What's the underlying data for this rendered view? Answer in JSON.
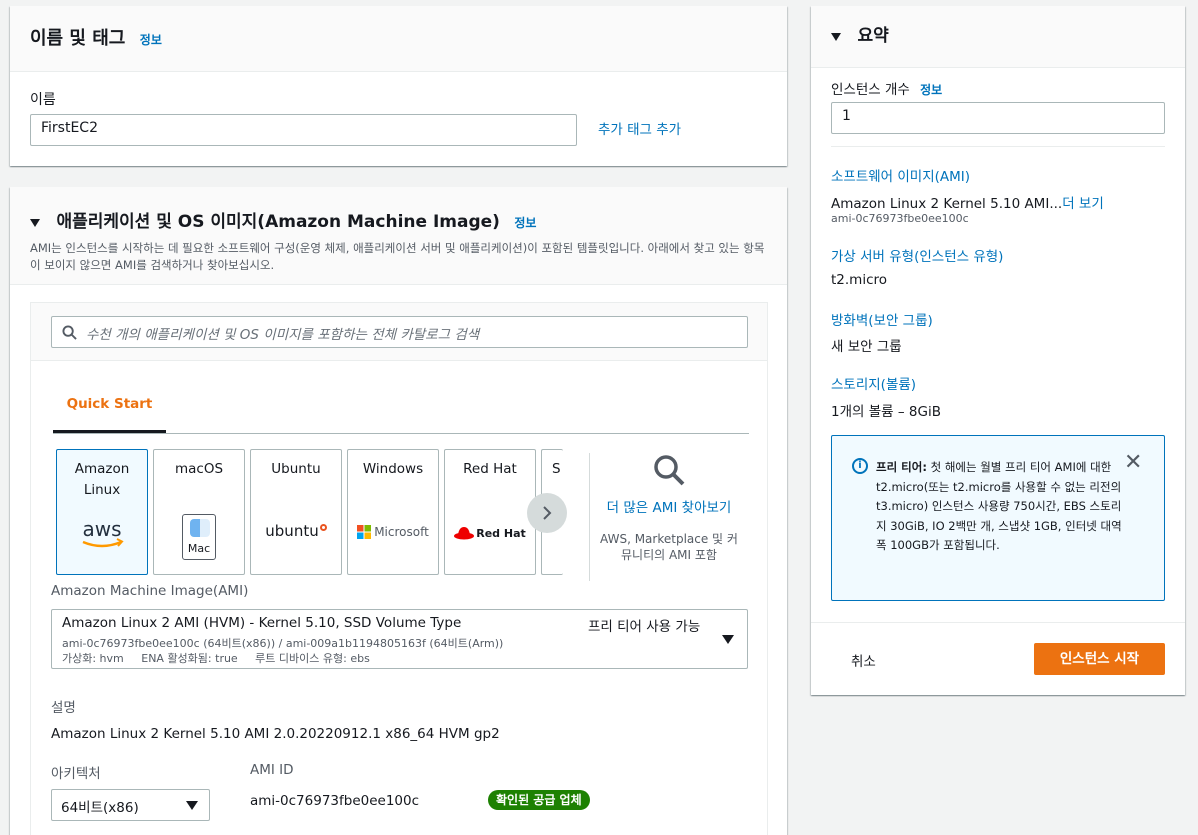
{
  "name_tags": {
    "title": "이름 및 태그",
    "info": "정보",
    "name_label": "이름",
    "name_value": "FirstEC2",
    "add_tags": "추가 태그 추가"
  },
  "ami_section": {
    "title": "애플리케이션 및 OS 이미지(Amazon Machine Image)",
    "info": "정보",
    "description": "AMI는 인스턴스를 시작하는 데 필요한 소프트웨어 구성(운영 체제, 애플리케이션 서버 및 애플리케이션)이 포함된 템플릿입니다. 아래에서 찾고 있는 항목이 보이지 않으면 AMI를 검색하거나 찾아보십시오.",
    "search_placeholder": "수천 개의 애플리케이션 및 OS 이미지를 포함하는 전체 카탈로그 검색",
    "tab_quick_start": "Quick Start",
    "tiles": [
      {
        "name_line1": "Amazon",
        "name_line2": "Linux",
        "logo": "aws",
        "selected": true
      },
      {
        "name_line1": "macOS",
        "logo": "Mac"
      },
      {
        "name_line1": "Ubuntu",
        "logo": "ubuntu"
      },
      {
        "name_line1": "Windows",
        "logo": "Microsoft"
      },
      {
        "name_line1": "Red Hat",
        "logo": "Red Hat"
      },
      {
        "name_line1": "S"
      }
    ],
    "more_ami_link": "더 많은 AMI 찾아보기",
    "more_ami_sub": "AWS, Marketplace 및 커뮤니티의 AMI 포함",
    "ami_label": "Amazon Machine Image(AMI)",
    "selected_ami": {
      "name": "Amazon Linux 2 AMI (HVM) - Kernel 5.10, SSD Volume Type",
      "ids": "ami-0c76973fbe0ee100c (64비트(x86)) / ami-009a1b1194805163f (64비트(Arm))",
      "details": "가상화: hvm     ENA 활성화됨: true     루트 디바이스 유형: ebs",
      "badge": "프리 티어 사용 가능"
    },
    "desc_label": "설명",
    "desc_value": "Amazon Linux 2 Kernel 5.10 AMI 2.0.20220912.1 x86_64 HVM gp2",
    "arch_label": "아키텍처",
    "arch_value": "64비트(x86)",
    "ami_id_label": "AMI ID",
    "ami_id_value": "ami-0c76973fbe0ee100c",
    "verified": "확인된 공급 업체"
  },
  "summary": {
    "title": "요약",
    "instance_count_label": "인스턴스 개수",
    "info": "정보",
    "instance_count": "1",
    "software_image_label": "소프트웨어 이미지(AMI)",
    "software_image_value": "Amazon Linux 2 Kernel 5.10 AMI...",
    "see_more": "더 보기",
    "software_image_id": "ami-0c76973fbe0ee100c",
    "instance_type_label": "가상 서버 유형(인스턴스 유형)",
    "instance_type_value": "t2.micro",
    "firewall_label": "방화벽(보안 그룹)",
    "firewall_value": "새 보안 그룹",
    "storage_label": "스토리지(볼륨)",
    "storage_value": "1개의 볼륨 – 8GiB",
    "free_tier_bold": "프리 티어:",
    "free_tier_text": " 첫 해에는 월별 프리 티어 AMI에 대한 t2.micro(또는 t2.micro를 사용할 수 없는 리전의 t3.micro) 인스턴스 사용량 750시간, EBS 스토리지 30GiB, IO 2백만 개, 스냅샷 1GB, 인터넷 대역폭 100GB가 포함됩니다.",
    "cancel": "취소",
    "launch": "인스턴스 시작"
  },
  "colors": {
    "accent_orange": "#ec7211",
    "link_blue": "#0073bb",
    "verified_green": "#1d8102"
  }
}
